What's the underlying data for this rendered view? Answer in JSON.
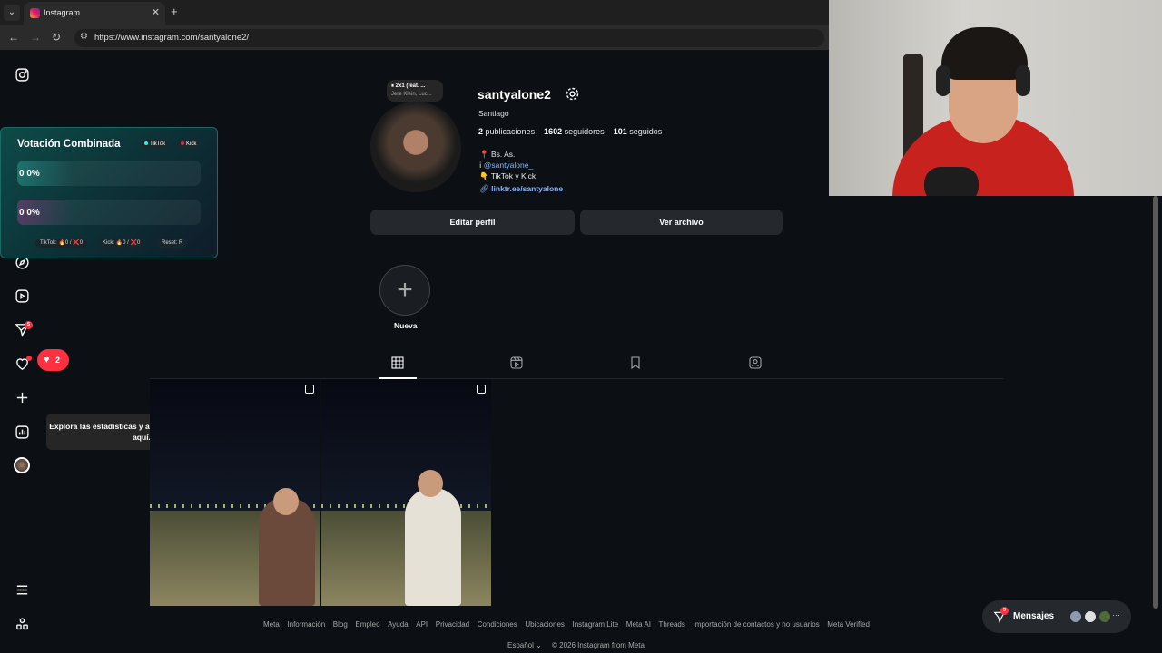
{
  "browser": {
    "tab_title": "Instagram",
    "url": "https://www.instagram.com/santyalone2/"
  },
  "vote_widget": {
    "title": "Votación Combinada",
    "pill_tiktok": "TikTok",
    "pill_kick": "Kick",
    "bar1_value": "0  0%",
    "bar2_value": "0  0%",
    "footer_tiktok": "TikTok: 🔥0 / ❌0",
    "footer_kick": "Kick: 🔥0 / ❌0",
    "footer_reset": "Reset: R"
  },
  "profile": {
    "note_line1": "⏸ 2x1 (feat. ...",
    "note_line2": "Jere Klein, Luc...",
    "username": "santyalone2",
    "full_name": "Santiago",
    "posts_count": "2",
    "posts_label": "publicaciones",
    "followers_count": "1602",
    "followers_label": "seguidores",
    "following_count": "101",
    "following_label": "seguidos",
    "bio_location": "📍 Bs. As.",
    "bio_handle": "@santyalone_",
    "bio_platforms": "👇 TikTok y Kick",
    "bio_link": "linktr.ee/santyalone",
    "edit_button": "Editar perfil",
    "archive_button": "Ver archivo",
    "new_highlight_label": "Nueva"
  },
  "sidebar": {
    "notifications_badge": "2",
    "messages_badge": "5",
    "tooltip": "Explora las estadísticas y administra tus anuncios aquí."
  },
  "footer": {
    "links": [
      "Meta",
      "Información",
      "Blog",
      "Empleo",
      "Ayuda",
      "API",
      "Privacidad",
      "Condiciones",
      "Ubicaciones",
      "Instagram Lite",
      "Meta AI",
      "Threads",
      "Importación de contactos y no usuarios",
      "Meta Verified"
    ],
    "language": "Español ⌄",
    "copyright": "© 2026 Instagram from Meta"
  },
  "messages_bar": {
    "label": "Mensajes",
    "badge": "5",
    "more": "···"
  },
  "colors": {
    "background": "#0c1014",
    "button": "#25292e",
    "badge": "#ff3040",
    "link": "#8ab4f8"
  }
}
